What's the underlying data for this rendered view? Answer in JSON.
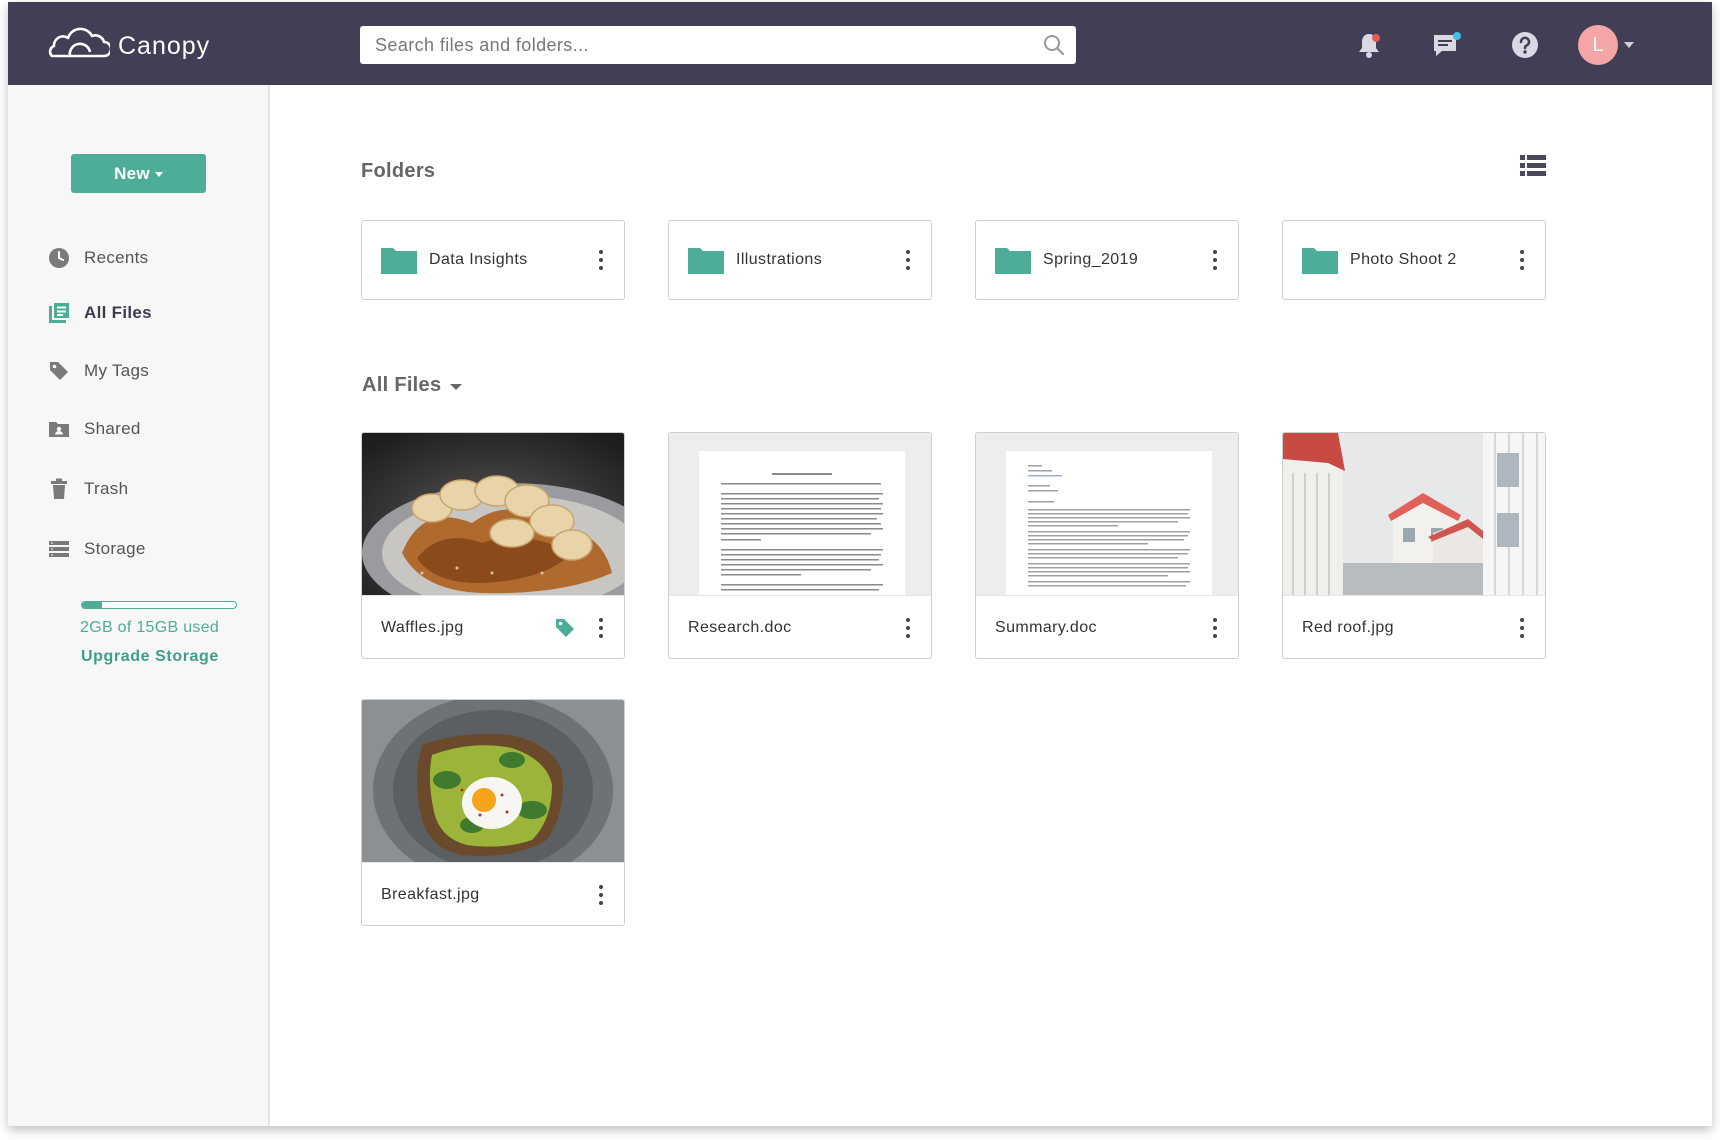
{
  "app": {
    "name": "Canopy"
  },
  "header": {
    "search_placeholder": "Search files and folders...",
    "avatar_initial": "L",
    "icons": [
      "bell-icon",
      "chat-icon",
      "help-icon"
    ]
  },
  "colors": {
    "header_bg": "#413e56",
    "accent": "#4ead99",
    "avatar": "#f4a6a6",
    "notification_dot": "#e85a5a",
    "chat_dot": "#3fc1e4"
  },
  "sidebar": {
    "new_label": "New",
    "items": [
      {
        "label": "Recents",
        "icon": "clock-icon",
        "active": false
      },
      {
        "label": "All Files",
        "icon": "files-icon",
        "active": true
      },
      {
        "label": "My Tags",
        "icon": "tag-icon",
        "active": false
      },
      {
        "label": "Shared",
        "icon": "shared-folder-icon",
        "active": false
      },
      {
        "label": "Trash",
        "icon": "trash-icon",
        "active": false
      },
      {
        "label": "Storage",
        "icon": "storage-icon",
        "active": false
      }
    ],
    "storage": {
      "used_text": "2GB of 15GB used",
      "used_fraction": 0.133,
      "upgrade_label": "Upgrade Storage"
    }
  },
  "main": {
    "folders_title": "Folders",
    "folders": [
      {
        "name": "Data Insights"
      },
      {
        "name": "Illustrations"
      },
      {
        "name": "Spring_2019"
      },
      {
        "name": "Photo Shoot 2"
      }
    ],
    "files_title": "All Files",
    "files": [
      {
        "name": "Waffles.jpg",
        "thumb": "waffles-photo",
        "tagged": true
      },
      {
        "name": "Research.doc",
        "thumb": "document-preview",
        "tagged": false
      },
      {
        "name": "Summary.doc",
        "thumb": "document-preview",
        "tagged": false
      },
      {
        "name": "Red roof.jpg",
        "thumb": "houses-photo",
        "tagged": false
      },
      {
        "name": "Breakfast.jpg",
        "thumb": "breakfast-photo",
        "tagged": false
      }
    ]
  }
}
